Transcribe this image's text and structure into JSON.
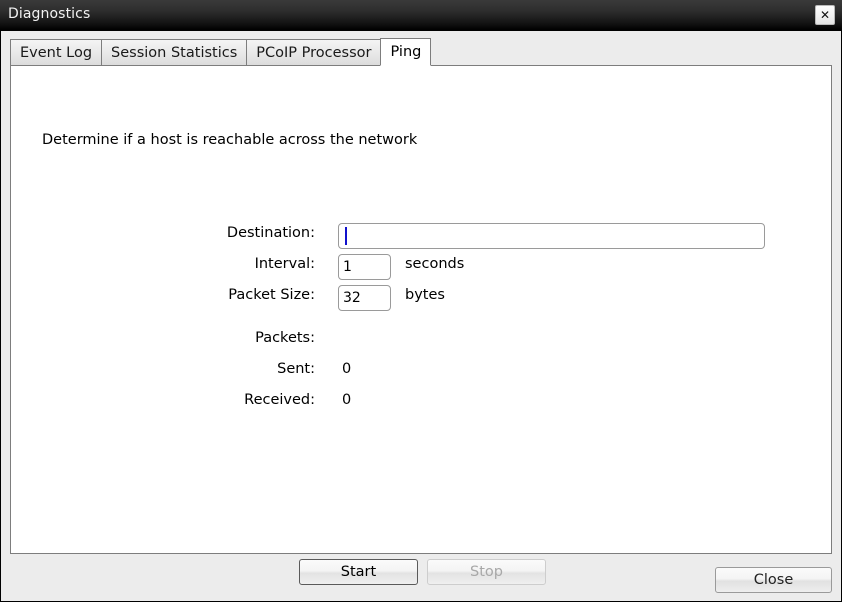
{
  "window": {
    "title": "Diagnostics",
    "close_icon": "close-icon",
    "close_glyph": "✕"
  },
  "tabs": [
    {
      "label": "Event Log",
      "active": false
    },
    {
      "label": "Session Statistics",
      "active": false
    },
    {
      "label": "PCoIP Processor",
      "active": false
    },
    {
      "label": "Ping",
      "active": true
    }
  ],
  "ping_panel": {
    "description": "Determine if a host is reachable across the network",
    "fields": {
      "destination": {
        "label": "Destination:",
        "value": "",
        "placeholder": ""
      },
      "interval": {
        "label": "Interval:",
        "value": "1",
        "unit": "seconds"
      },
      "packet_size": {
        "label": "Packet Size:",
        "value": "32",
        "unit": "bytes"
      }
    },
    "packets": {
      "group_label": "Packets:",
      "sent_label": "Sent:",
      "sent_value": "0",
      "received_label": "Received:",
      "received_value": "0"
    },
    "buttons": {
      "start": "Start",
      "stop": "Stop"
    }
  },
  "footer": {
    "close": "Close"
  },
  "colors": {
    "titlebar_top": "#3a3a3a",
    "titlebar_bottom": "#000000",
    "window_bg": "#ececec",
    "panel_bg": "#ffffff",
    "border": "#7d7d7d",
    "caret": "#1111cc",
    "disabled_text": "#a8a8a8"
  }
}
